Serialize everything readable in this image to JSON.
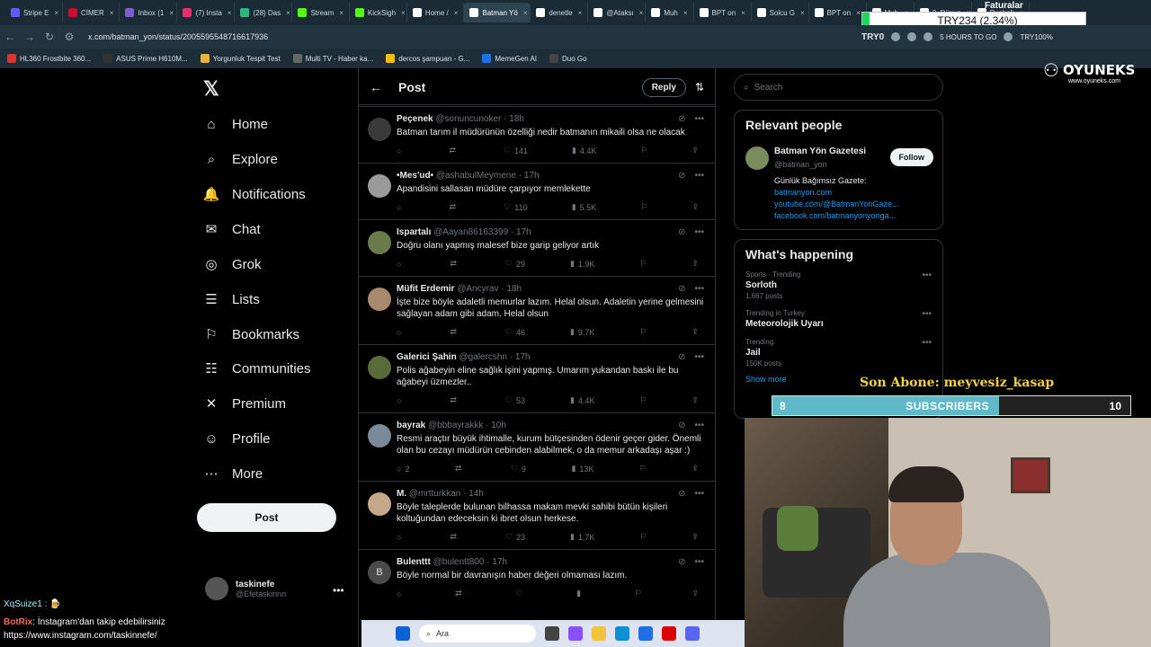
{
  "browser": {
    "tabs": [
      {
        "label": "Stripe E",
        "color": "#635bff"
      },
      {
        "label": "CİMER",
        "color": "#c8102e"
      },
      {
        "label": "Inbox (1",
        "color": "#7b5cd6"
      },
      {
        "label": "(7) Insta",
        "color": "#e1306c"
      },
      {
        "label": "(28) Das",
        "color": "#2eb67d"
      },
      {
        "label": "Stream",
        "color": "#53fc18"
      },
      {
        "label": "KickSigh",
        "color": "#53fc18"
      },
      {
        "label": "Home /",
        "color": "#ffffff"
      },
      {
        "label": "Batman Yö",
        "color": "#ffffff",
        "active": true
      },
      {
        "label": "denetle",
        "color": "#ffffff"
      },
      {
        "label": "@Ataksı",
        "color": "#ffffff"
      },
      {
        "label": "Muh",
        "color": "#ffffff"
      },
      {
        "label": "BPT on",
        "color": "#ffffff"
      },
      {
        "label": "Solcu G",
        "color": "#ffffff"
      },
      {
        "label": "BPT on",
        "color": "#ffffff"
      },
      {
        "label": "Muh",
        "color": "#ffffff"
      },
      {
        "label": "3. Dünya",
        "color": "#ffffff"
      },
      {
        "label": "Pusholi",
        "color": "#ffffff"
      }
    ],
    "url": "x.com/batman_yon/status/2005595548716617936",
    "ext_labels": [
      "TRY0",
      "5 HOURS TO GO",
      "TRY100%"
    ],
    "bookmarks": [
      {
        "label": "HL360 Frostbite 360...",
        "color": "#d33"
      },
      {
        "label": "ASUS Prime H610M...",
        "color": "#333"
      },
      {
        "label": "Yorgunluk Tespit Test",
        "color": "#e8b339"
      },
      {
        "label": "Multi TV - Haber ka...",
        "color": "#666"
      },
      {
        "label": "dercos şampuan - G...",
        "color": "#fbbc05"
      },
      {
        "label": "MemeGen AI",
        "color": "#1a73e8"
      },
      {
        "label": "Duo Go",
        "color": "#444"
      }
    ]
  },
  "ticker": {
    "label": "TRY234 (2.34%)",
    "top": "Faturalar"
  },
  "leftnav": {
    "items": [
      {
        "label": "Home",
        "icon": "⌂",
        "name": "home"
      },
      {
        "label": "Explore",
        "icon": "⌕",
        "name": "explore"
      },
      {
        "label": "Notifications",
        "icon": "🔔",
        "name": "notifications"
      },
      {
        "label": "Chat",
        "icon": "✉",
        "name": "chat"
      },
      {
        "label": "Grok",
        "icon": "◎",
        "name": "grok"
      },
      {
        "label": "Lists",
        "icon": "☰",
        "name": "lists"
      },
      {
        "label": "Bookmarks",
        "icon": "⚐",
        "name": "bookmarks"
      },
      {
        "label": "Communities",
        "icon": "☷",
        "name": "communities"
      },
      {
        "label": "Premium",
        "icon": "✕",
        "name": "premium"
      },
      {
        "label": "Profile",
        "icon": "☺",
        "name": "profile"
      },
      {
        "label": "More",
        "icon": "⋯",
        "name": "more"
      }
    ],
    "post_label": "Post",
    "user_name": "taskinefe",
    "user_handle": "@Efetaskinnn"
  },
  "center": {
    "title": "Post",
    "reply_label": "Reply",
    "tweets": [
      {
        "name": "Peçenek",
        "handle": "@sonuncunoker",
        "time": "18h",
        "text": "Batman tarım il müdürünün özelliği nedir batmanın mikaili olsa ne olacak",
        "replies": "",
        "reposts": "",
        "likes": "141",
        "views": "4.4K",
        "av": "#3a3a3a"
      },
      {
        "name": "•Mes'ud•",
        "handle": "@ashabulMeymene",
        "time": "17h",
        "text": "Apandisini sallasan müdüre çarpıyor memlekette",
        "replies": "",
        "reposts": "",
        "likes": "110",
        "views": "5.5K",
        "av": "#9a9a9a"
      },
      {
        "name": "Ispartalı",
        "handle": "@Aayan86163399",
        "time": "17h",
        "text": "Doğru olanı yapmış malesef bize garip geliyor artık",
        "replies": "",
        "reposts": "",
        "likes": "29",
        "views": "1.9K",
        "av": "#6b7a4a"
      },
      {
        "name": "Müfit Erdemir",
        "handle": "@Ancyrav",
        "time": "18h",
        "text": "İşte bize böyle adaletli memurlar lazım. Helal olsun. Adaletin yerine gelmesini sağlayan adam gibi adam. Helal olsun",
        "replies": "",
        "reposts": "",
        "likes": "46",
        "views": "9.7K",
        "av": "#a8896c"
      },
      {
        "name": "Galerici Şahin",
        "handle": "@galercshn",
        "time": "17h",
        "text": "Polis ağabeyin eline sağlık işini yapmış. Umarım yukandan baskı ile bu ağabeyi üzmezler..",
        "replies": "",
        "reposts": "",
        "likes": "53",
        "views": "4.4K",
        "av": "#5a6b3a"
      },
      {
        "name": "bayrak",
        "handle": "@bbbayrakkk",
        "time": "10h",
        "text": "Resmi araçtır büyük ihtimalle, kurum bütçesinden ödenir geçer gider. Önemli olan bu cezayı müdürün cebinden alabilmek, o da memur arkadaşı aşar :)",
        "replies": "2",
        "reposts": "",
        "likes": "9",
        "views": "13K",
        "av": "#7a8a9a"
      },
      {
        "name": "M.",
        "handle": "@mrtturkkan",
        "time": "14h",
        "text": "Böyle taleplerde bulunan bilhassa makam mevki sahibi bütün kişileri koltuğundan edeceksin ki ibret olsun herkese.",
        "replies": "",
        "reposts": "",
        "likes": "23",
        "views": "1.7K",
        "av": "#c7a78a"
      },
      {
        "name": "Bulenttt",
        "handle": "@bulentt800",
        "time": "17h",
        "text": "Böyle normal bir davranışın haber değeri olmaması lazım.",
        "replies": "",
        "reposts": "",
        "likes": "",
        "views": "",
        "av": "#4a4a4a",
        "initial": "B"
      }
    ]
  },
  "right": {
    "search_placeholder": "Search",
    "relevant_title": "Relevant people",
    "rp_name": "Batman Yön Gazetesi",
    "rp_handle": "@batman_yon",
    "follow_label": "Follow",
    "rp_bio": "Günlük Bağımsız Gazete:",
    "rp_links": [
      "batmanyon.com",
      "youtube.com/@BatmanYonGaze...",
      "facebook.com/batmanyonyonga..."
    ],
    "happening_title": "What's happening",
    "trends": [
      {
        "cat": "Sports · Trending",
        "name": "Sorloth",
        "count": "1,667 posts"
      },
      {
        "cat": "Trending in Turkey",
        "name": "Meteorolojik Uyarı",
        "count": ""
      },
      {
        "cat": "Trending",
        "name": "Jail",
        "count": "150K posts"
      }
    ],
    "show_more": "Show more"
  },
  "overlay": {
    "brand": "OYUNEKS",
    "brand_url": "www.oyuneks.com",
    "son_abone": "Son Abone: meyvesiz_kasap",
    "sub_current": "8",
    "sub_label": "SUBSCRIBERS",
    "sub_goal": "10",
    "sub_progress": 0.8,
    "chat1_user": "XqSuize1 :",
    "chat2_user": "BotRix",
    "chat2_msg": ": İnstagram'dan takip edebilirsiniz",
    "chat_url": "https://www.instagram.com/taskinnefe/",
    "taskbar_search": "Ara"
  }
}
